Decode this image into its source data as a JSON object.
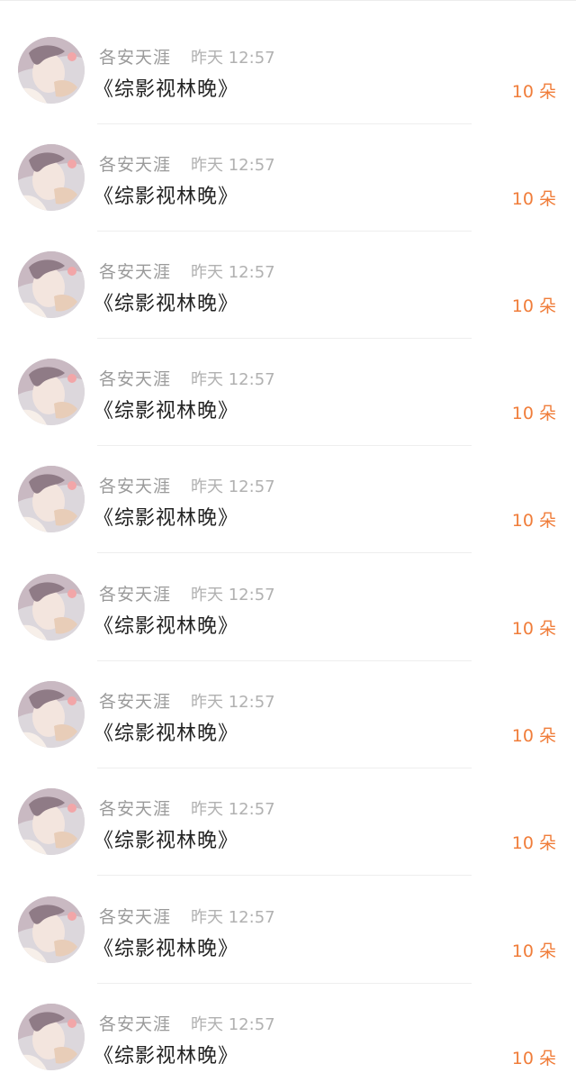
{
  "colors": {
    "accent": "#f07d3a",
    "name_text": "#9a9a9a",
    "time_text": "#b1b1b1",
    "title_text": "#222222",
    "divider": "#eeeeee"
  },
  "items": [
    {
      "name": "各安天涯",
      "time": "昨天 12:57",
      "title": "《综影视林晚》",
      "amount": "10 朵",
      "avatar_icon": "user-avatar-image"
    },
    {
      "name": "各安天涯",
      "time": "昨天 12:57",
      "title": "《综影视林晚》",
      "amount": "10 朵",
      "avatar_icon": "user-avatar-image"
    },
    {
      "name": "各安天涯",
      "time": "昨天 12:57",
      "title": "《综影视林晚》",
      "amount": "10 朵",
      "avatar_icon": "user-avatar-image"
    },
    {
      "name": "各安天涯",
      "time": "昨天 12:57",
      "title": "《综影视林晚》",
      "amount": "10 朵",
      "avatar_icon": "user-avatar-image"
    },
    {
      "name": "各安天涯",
      "time": "昨天 12:57",
      "title": "《综影视林晚》",
      "amount": "10 朵",
      "avatar_icon": "user-avatar-image"
    },
    {
      "name": "各安天涯",
      "time": "昨天 12:57",
      "title": "《综影视林晚》",
      "amount": "10 朵",
      "avatar_icon": "user-avatar-image"
    },
    {
      "name": "各安天涯",
      "time": "昨天 12:57",
      "title": "《综影视林晚》",
      "amount": "10 朵",
      "avatar_icon": "user-avatar-image"
    },
    {
      "name": "各安天涯",
      "time": "昨天 12:57",
      "title": "《综影视林晚》",
      "amount": "10 朵",
      "avatar_icon": "user-avatar-image"
    },
    {
      "name": "各安天涯",
      "time": "昨天 12:57",
      "title": "《综影视林晚》",
      "amount": "10 朵",
      "avatar_icon": "user-avatar-image"
    },
    {
      "name": "各安天涯",
      "time": "昨天 12:57",
      "title": "《综影视林晚》",
      "amount": "10 朵",
      "avatar_icon": "user-avatar-image"
    }
  ]
}
